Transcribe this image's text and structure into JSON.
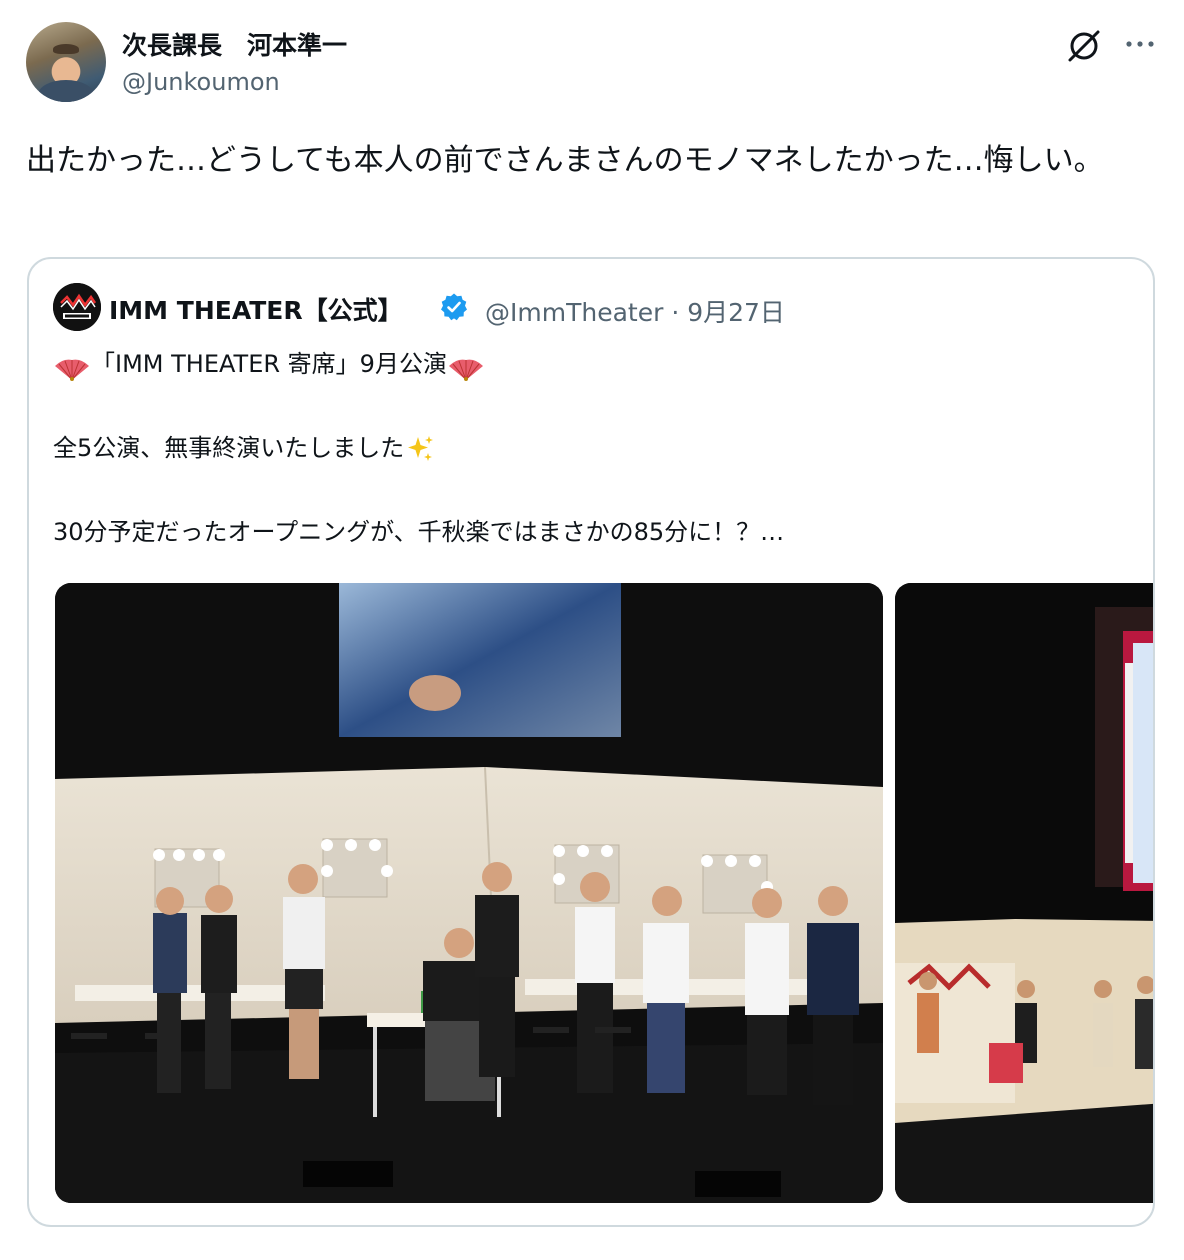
{
  "author": {
    "display_name": "次長課長　河本準一",
    "handle": "@Junkoumon"
  },
  "icons": {
    "grok": "grok-icon",
    "more": "more-icon",
    "verified": "verified-badge-icon",
    "fan": "folding-fan-emoji",
    "sparkles": "sparkles-emoji"
  },
  "post": {
    "text": "出たかった…どうしても本人の前でさんまさんのモノマネしたかった…悔しい。"
  },
  "quoted": {
    "name": "IMM THEATER【公式】",
    "handle": "@ImmTheater",
    "separator": "·",
    "date": "9月27日",
    "line1": "「IMM THEATER 寄席」9月公演",
    "line2": "全5公演、無事終演いたしました",
    "line3": "30分予定だったオープニングが、千秋楽ではまさかの85分に！？…",
    "logo_text": "IMM THEATER",
    "images": [
      "stage-photo-performers",
      "stage-photo-opening"
    ]
  },
  "colors": {
    "text": "#0f1419",
    "secondary": "#536471",
    "border": "#cfd9de",
    "verified": "#1d9bf0"
  }
}
